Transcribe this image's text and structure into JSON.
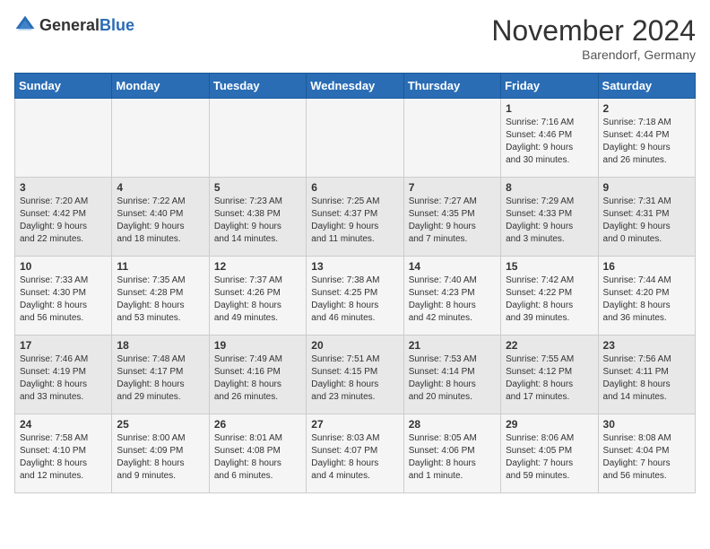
{
  "logo": {
    "text_general": "General",
    "text_blue": "Blue"
  },
  "header": {
    "month": "November 2024",
    "location": "Barendorf, Germany"
  },
  "weekdays": [
    "Sunday",
    "Monday",
    "Tuesday",
    "Wednesday",
    "Thursday",
    "Friday",
    "Saturday"
  ],
  "weeks": [
    [
      {
        "day": "",
        "info": ""
      },
      {
        "day": "",
        "info": ""
      },
      {
        "day": "",
        "info": ""
      },
      {
        "day": "",
        "info": ""
      },
      {
        "day": "",
        "info": ""
      },
      {
        "day": "1",
        "info": "Sunrise: 7:16 AM\nSunset: 4:46 PM\nDaylight: 9 hours\nand 30 minutes."
      },
      {
        "day": "2",
        "info": "Sunrise: 7:18 AM\nSunset: 4:44 PM\nDaylight: 9 hours\nand 26 minutes."
      }
    ],
    [
      {
        "day": "3",
        "info": "Sunrise: 7:20 AM\nSunset: 4:42 PM\nDaylight: 9 hours\nand 22 minutes."
      },
      {
        "day": "4",
        "info": "Sunrise: 7:22 AM\nSunset: 4:40 PM\nDaylight: 9 hours\nand 18 minutes."
      },
      {
        "day": "5",
        "info": "Sunrise: 7:23 AM\nSunset: 4:38 PM\nDaylight: 9 hours\nand 14 minutes."
      },
      {
        "day": "6",
        "info": "Sunrise: 7:25 AM\nSunset: 4:37 PM\nDaylight: 9 hours\nand 11 minutes."
      },
      {
        "day": "7",
        "info": "Sunrise: 7:27 AM\nSunset: 4:35 PM\nDaylight: 9 hours\nand 7 minutes."
      },
      {
        "day": "8",
        "info": "Sunrise: 7:29 AM\nSunset: 4:33 PM\nDaylight: 9 hours\nand 3 minutes."
      },
      {
        "day": "9",
        "info": "Sunrise: 7:31 AM\nSunset: 4:31 PM\nDaylight: 9 hours\nand 0 minutes."
      }
    ],
    [
      {
        "day": "10",
        "info": "Sunrise: 7:33 AM\nSunset: 4:30 PM\nDaylight: 8 hours\nand 56 minutes."
      },
      {
        "day": "11",
        "info": "Sunrise: 7:35 AM\nSunset: 4:28 PM\nDaylight: 8 hours\nand 53 minutes."
      },
      {
        "day": "12",
        "info": "Sunrise: 7:37 AM\nSunset: 4:26 PM\nDaylight: 8 hours\nand 49 minutes."
      },
      {
        "day": "13",
        "info": "Sunrise: 7:38 AM\nSunset: 4:25 PM\nDaylight: 8 hours\nand 46 minutes."
      },
      {
        "day": "14",
        "info": "Sunrise: 7:40 AM\nSunset: 4:23 PM\nDaylight: 8 hours\nand 42 minutes."
      },
      {
        "day": "15",
        "info": "Sunrise: 7:42 AM\nSunset: 4:22 PM\nDaylight: 8 hours\nand 39 minutes."
      },
      {
        "day": "16",
        "info": "Sunrise: 7:44 AM\nSunset: 4:20 PM\nDaylight: 8 hours\nand 36 minutes."
      }
    ],
    [
      {
        "day": "17",
        "info": "Sunrise: 7:46 AM\nSunset: 4:19 PM\nDaylight: 8 hours\nand 33 minutes."
      },
      {
        "day": "18",
        "info": "Sunrise: 7:48 AM\nSunset: 4:17 PM\nDaylight: 8 hours\nand 29 minutes."
      },
      {
        "day": "19",
        "info": "Sunrise: 7:49 AM\nSunset: 4:16 PM\nDaylight: 8 hours\nand 26 minutes."
      },
      {
        "day": "20",
        "info": "Sunrise: 7:51 AM\nSunset: 4:15 PM\nDaylight: 8 hours\nand 23 minutes."
      },
      {
        "day": "21",
        "info": "Sunrise: 7:53 AM\nSunset: 4:14 PM\nDaylight: 8 hours\nand 20 minutes."
      },
      {
        "day": "22",
        "info": "Sunrise: 7:55 AM\nSunset: 4:12 PM\nDaylight: 8 hours\nand 17 minutes."
      },
      {
        "day": "23",
        "info": "Sunrise: 7:56 AM\nSunset: 4:11 PM\nDaylight: 8 hours\nand 14 minutes."
      }
    ],
    [
      {
        "day": "24",
        "info": "Sunrise: 7:58 AM\nSunset: 4:10 PM\nDaylight: 8 hours\nand 12 minutes."
      },
      {
        "day": "25",
        "info": "Sunrise: 8:00 AM\nSunset: 4:09 PM\nDaylight: 8 hours\nand 9 minutes."
      },
      {
        "day": "26",
        "info": "Sunrise: 8:01 AM\nSunset: 4:08 PM\nDaylight: 8 hours\nand 6 minutes."
      },
      {
        "day": "27",
        "info": "Sunrise: 8:03 AM\nSunset: 4:07 PM\nDaylight: 8 hours\nand 4 minutes."
      },
      {
        "day": "28",
        "info": "Sunrise: 8:05 AM\nSunset: 4:06 PM\nDaylight: 8 hours\nand 1 minute."
      },
      {
        "day": "29",
        "info": "Sunrise: 8:06 AM\nSunset: 4:05 PM\nDaylight: 7 hours\nand 59 minutes."
      },
      {
        "day": "30",
        "info": "Sunrise: 8:08 AM\nSunset: 4:04 PM\nDaylight: 7 hours\nand 56 minutes."
      }
    ]
  ]
}
